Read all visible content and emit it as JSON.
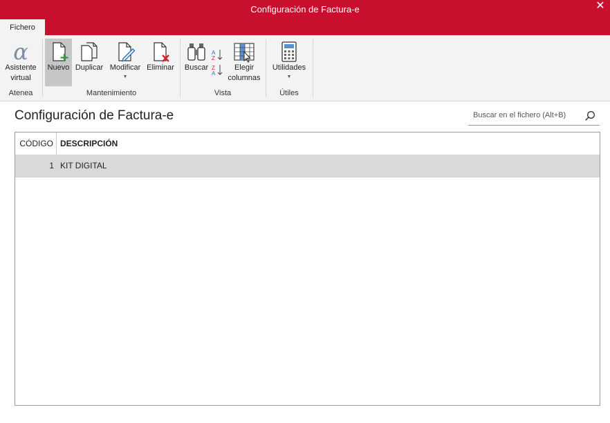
{
  "window": {
    "title": "Configuración de Factura-e",
    "close_glyph": "✕"
  },
  "tabs": [
    {
      "label": "Fichero"
    }
  ],
  "ribbon": {
    "groups": [
      {
        "label": "Atenea",
        "buttons": [
          {
            "label": "Asistente virtual",
            "icon": "alpha-icon"
          }
        ]
      },
      {
        "label": "Mantenimiento",
        "buttons": [
          {
            "label": "Nuevo",
            "icon": "new-document-icon",
            "active": true
          },
          {
            "label": "Duplicar",
            "icon": "duplicate-icon"
          },
          {
            "label": "Modificar",
            "icon": "edit-document-icon",
            "dropdown": true
          },
          {
            "label": "Eliminar",
            "icon": "delete-document-icon"
          }
        ]
      },
      {
        "label": "Vista",
        "buttons": [
          {
            "label": "Buscar",
            "icon": "binoculars-icon"
          },
          {
            "label": "Elegir columnas",
            "icon": "choose-columns-icon"
          }
        ]
      },
      {
        "label": "Útiles",
        "buttons": [
          {
            "label": "Utilidades",
            "icon": "calculator-icon",
            "dropdown": true
          }
        ]
      }
    ]
  },
  "main": {
    "title": "Configuración de Factura-e",
    "search": {
      "placeholder": "Buscar en el fichero (Alt+B)",
      "value": ""
    },
    "table": {
      "columns": [
        "CÓDIGO",
        "DESCRIPCIÓN"
      ],
      "rows": [
        {
          "codigo": "1",
          "descripcion": "KIT DIGITAL"
        }
      ]
    }
  },
  "colors": {
    "brand": "#c8102e",
    "ribbon_bg": "#f3f3f3",
    "selected_row": "#d9d9d9"
  }
}
